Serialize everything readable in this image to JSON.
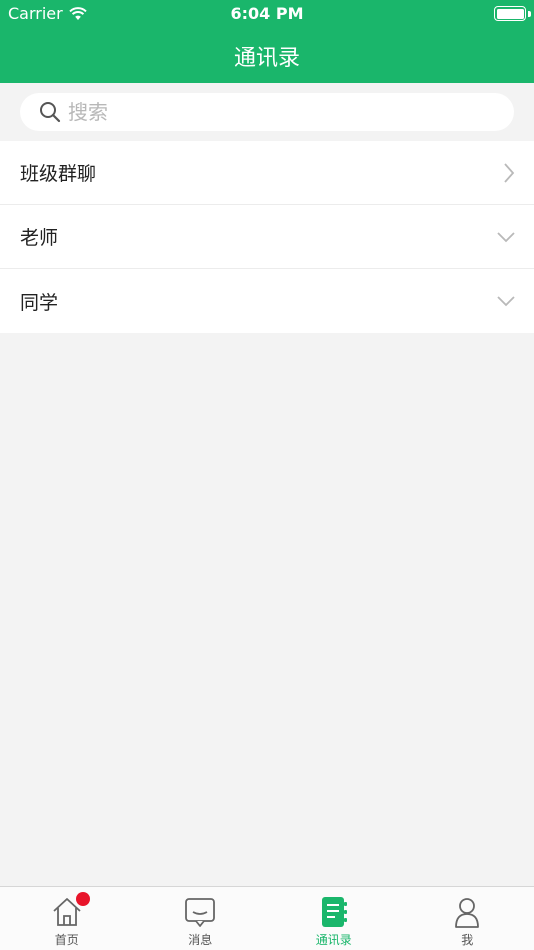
{
  "status_bar": {
    "carrier": "Carrier",
    "time": "6:04 PM"
  },
  "nav": {
    "title": "通讯录"
  },
  "search": {
    "placeholder": "搜索"
  },
  "list": {
    "items": [
      {
        "label": "班级群聊",
        "arrow": "chevron-right-icon"
      },
      {
        "label": "老师",
        "arrow": "chevron-down-icon"
      },
      {
        "label": "同学",
        "arrow": "chevron-down-icon"
      }
    ]
  },
  "tabbar": {
    "tabs": [
      {
        "label": "首页",
        "icon": "home-icon",
        "badge": true
      },
      {
        "label": "消息",
        "icon": "message-icon",
        "badge": false
      },
      {
        "label": "通讯录",
        "icon": "contacts-icon",
        "active": true
      },
      {
        "label": "我",
        "icon": "person-icon",
        "badge": false
      }
    ]
  },
  "colors": {
    "accent": "#1ab66b",
    "badge": "#e8142a",
    "background": "#f3f3f3"
  }
}
